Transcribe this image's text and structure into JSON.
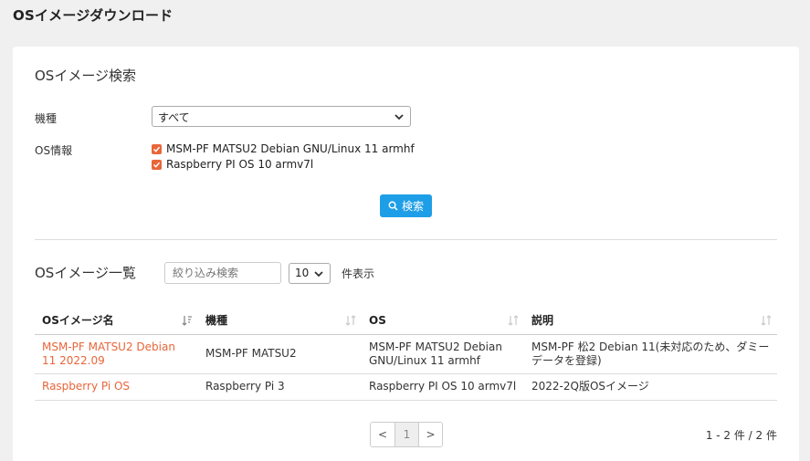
{
  "page": {
    "title": "OSイメージダウンロード"
  },
  "search": {
    "title": "OSイメージ検索",
    "model_label": "機種",
    "model_value": "すべて",
    "os_label": "OS情報",
    "os_options": [
      {
        "label": "MSM-PF MATSU2 Debian GNU/Linux 11 armhf",
        "checked": true
      },
      {
        "label": "Raspberry PI OS 10 armv7l",
        "checked": true
      }
    ],
    "button_label": "検索"
  },
  "list": {
    "title": "OSイメージ一覧",
    "filter_placeholder": "絞り込み検索",
    "page_size": "10",
    "page_size_suffix": "件表示",
    "columns": [
      "OSイメージ名",
      "機種",
      "OS",
      "説明"
    ],
    "rows": [
      {
        "name": "MSM-PF MATSU2 Debian 11 2022.09",
        "model": "MSM-PF MATSU2",
        "os": "MSM-PF MATSU2 Debian GNU/Linux 11 armhf",
        "description": "MSM-PF 松2 Debian 11(未対応のため、ダミーデータを登録)"
      },
      {
        "name": "Raspberry Pi OS",
        "model": "Raspberry Pi 3",
        "os": "Raspberry PI OS 10 armv7l",
        "description": "2022-2Q版OSイメージ"
      }
    ]
  },
  "pagination": {
    "prev": "<",
    "current": "1",
    "next": ">",
    "summary": "1 - 2 件 / 2 件"
  },
  "colors": {
    "accent": "#e8663a",
    "primary_button": "#1f9ee8"
  }
}
